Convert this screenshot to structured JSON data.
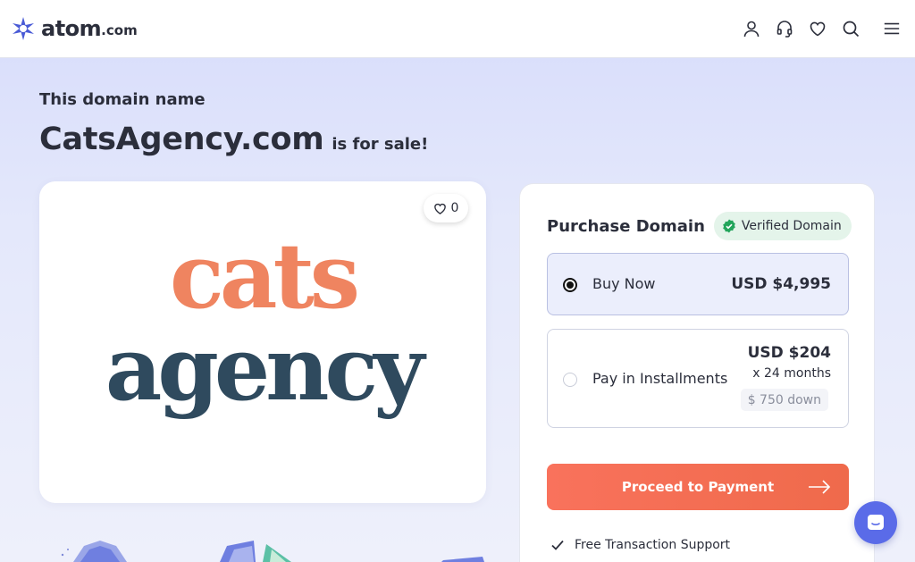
{
  "header": {
    "logo_text": "atom",
    "logo_suffix": ".com",
    "icons": [
      "account-icon",
      "support-headset-icon",
      "favorites-heart-icon",
      "search-icon",
      "menu-icon"
    ]
  },
  "hero": {
    "eyebrow": "This domain name",
    "domain": "CatsAgency.com",
    "for_sale": "is for sale!"
  },
  "logo_card": {
    "likes": "0",
    "brand_line1": "cats",
    "brand_line2": "agency",
    "brand_colors": {
      "cats": "#ef8460",
      "agency": "#2f4a5e"
    }
  },
  "purchase": {
    "title": "Purchase Domain",
    "verified_label": "Verified Domain",
    "options": [
      {
        "label": "Buy Now",
        "price": "USD $4,995",
        "selected": true
      },
      {
        "label": "Pay in Installments",
        "price": "USD $204",
        "term": "x 24 months",
        "down": "$ 750 down",
        "selected": false
      }
    ],
    "cta_label": "Proceed to Payment",
    "features": [
      "Free Transaction Support"
    ]
  },
  "colors": {
    "accent": "#f9725c",
    "brand": "#4a5bd6",
    "verified": "#22a55b",
    "chat": "#5a6be8"
  }
}
